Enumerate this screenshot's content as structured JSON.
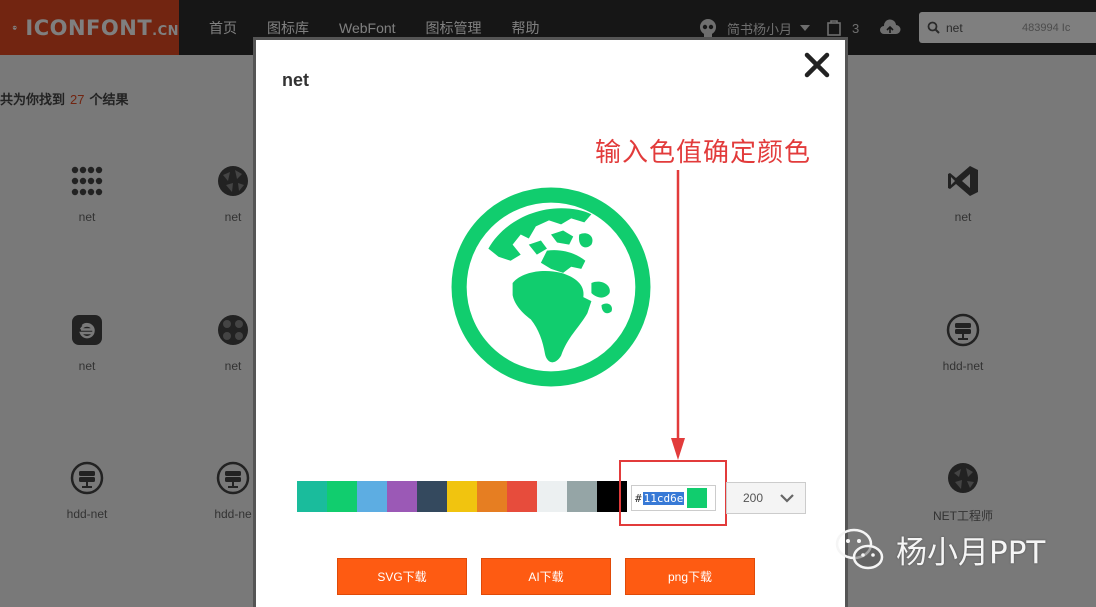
{
  "header": {
    "logo_text": "ICONFONT",
    "logo_suffix": ".CN",
    "nav": [
      "首页",
      "图标库",
      "WebFont",
      "图标管理",
      "帮助"
    ],
    "username": "简书杨小月",
    "cart_count": "3",
    "search_value": "net",
    "search_count": "483994 Ic"
  },
  "results": {
    "prefix": "共为你找到",
    "count": "27",
    "suffix": "个结果"
  },
  "grid": [
    {
      "label": "net",
      "icon": "dots-grid-icon"
    },
    {
      "label": "net",
      "icon": "globe-network-icon"
    },
    {
      "label": "net",
      "icon": "visual-studio-icon"
    },
    {
      "label": "net",
      "icon": "ie-browser-icon"
    },
    {
      "label": "net",
      "icon": "globe-network-icon"
    },
    {
      "label": "hdd-net",
      "icon": "hdd-net-icon"
    },
    {
      "label": "hdd-net",
      "icon": "hdd-net-icon"
    },
    {
      "label": "hdd-ne",
      "icon": "hdd-net-icon"
    },
    {
      "label": "NET工程师",
      "icon": "globe-network-icon"
    }
  ],
  "modal": {
    "title": "net",
    "close_icon": "close-icon",
    "preview_icon": "earth-globe-icon",
    "icon_color": "#11cd6e",
    "palette": [
      "#1abc9c",
      "#11cd6e",
      "#5dade2",
      "#9b59b6",
      "#34495e",
      "#f1c40f",
      "#e67e22",
      "#e74c3c",
      "#ecf0f1",
      "#95a5a6",
      "#000000"
    ],
    "hash": "#",
    "color_value": "11cd6e",
    "size_value": "200",
    "annotation": "输入色值确定颜色",
    "buttons": {
      "svg": "SVG下载",
      "ai": "AI下载",
      "png": "png下载"
    }
  },
  "watermark": {
    "text": "杨小月PPT",
    "icon": "wechat-icon"
  }
}
